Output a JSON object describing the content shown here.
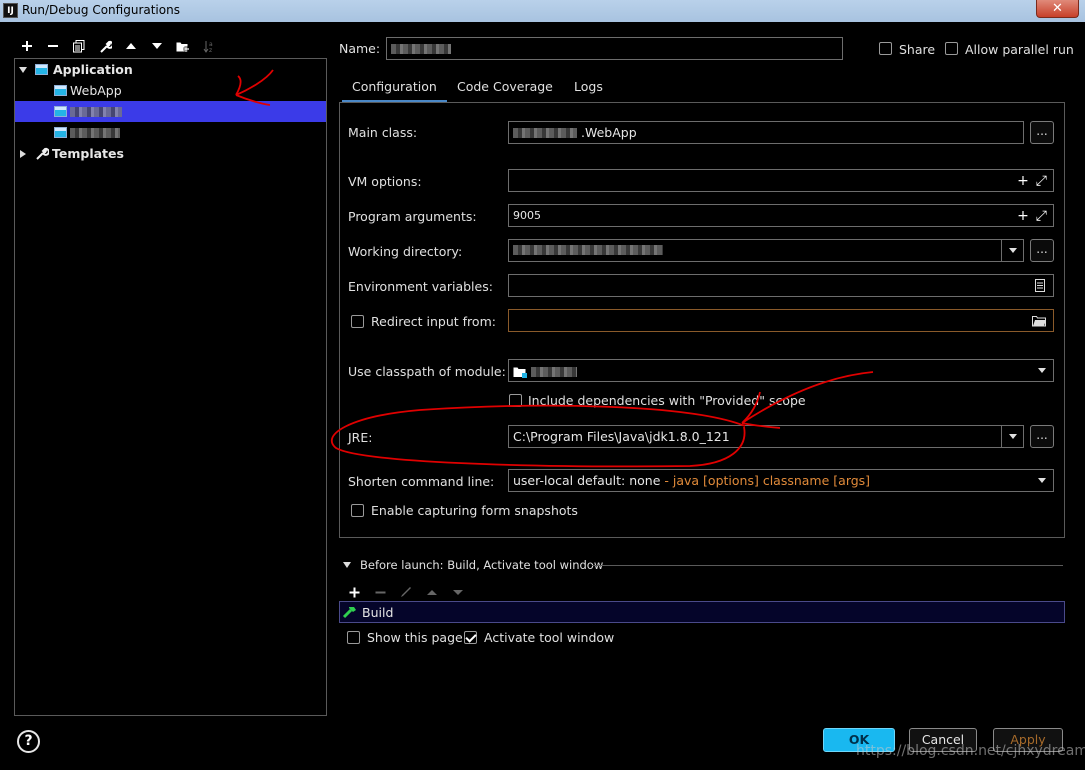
{
  "window": {
    "title": "Run/Debug Configurations",
    "icon_text": "IJ",
    "close_label": "✕"
  },
  "toolbar_icons": [
    "add-icon",
    "remove-icon",
    "copy-icon",
    "wrench-icon",
    "move-up-icon",
    "move-down-icon",
    "new-folder-icon",
    "sort-icon"
  ],
  "tree": {
    "application_label": "Application",
    "items": [
      {
        "label": "WebApp"
      }
    ],
    "templates_label": "Templates"
  },
  "name_label": "Name:",
  "share_label": "Share",
  "allow_parallel_label": "Allow parallel run",
  "tabs": [
    {
      "label": "Configuration"
    },
    {
      "label": "Code Coverage"
    },
    {
      "label": "Logs"
    }
  ],
  "form": {
    "main_class_label": "Main class:",
    "main_class_value": ".WebApp",
    "vm_options_label": "VM options:",
    "program_args_label": "Program arguments:",
    "program_args_value": "9005",
    "working_dir_label": "Working directory:",
    "env_vars_label": "Environment variables:",
    "redirect_label": "Redirect input from:",
    "classpath_label": "Use classpath of module:",
    "include_deps_label": "Include dependencies with \"Provided\" scope",
    "jre_label": "JRE:",
    "jre_value": "C:\\Program Files\\Java\\jdk1.8.0_121",
    "shorten_label": "Shorten command line:",
    "shorten_value": "user-local default: none",
    "shorten_hint": " - java [options] classname [args]",
    "snapshots_label": "Enable capturing form snapshots"
  },
  "before_launch": {
    "header": "Before launch: Build, Activate tool window",
    "items": [
      {
        "label": "Build"
      }
    ],
    "show_page_label": "Show this page",
    "activate_label": "Activate tool window"
  },
  "buttons": {
    "ok": "OK",
    "cancel": "Cancel",
    "apply": "Apply",
    "help": "?"
  },
  "watermark": "https://blog.csdn.net/cjhxydream",
  "colors": {
    "selection": "#3b3be8",
    "ok_button": "#19b8f0",
    "annotation_red": "#e00000",
    "hint_orange": "#e08a3a"
  }
}
